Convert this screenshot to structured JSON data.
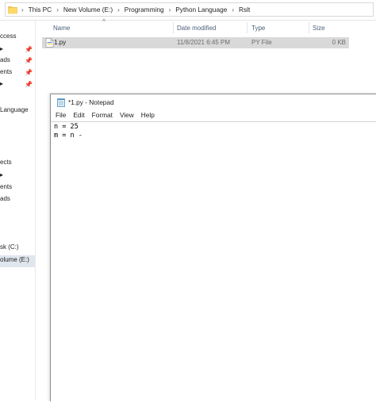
{
  "explorer": {
    "breadcrumbs": [
      "This PC",
      "New Volume (E:)",
      "Programming",
      "Python Language",
      "Rslt"
    ],
    "columns": {
      "name": "Name",
      "date_modified": "Date modified",
      "type": "Type",
      "size": "Size"
    },
    "files": [
      {
        "name": "1.py",
        "date_modified": "11/8/2021 6:45 PM",
        "type": "PY File",
        "size": "0 KB"
      }
    ],
    "sidebar_items": [
      {
        "label": "ccess",
        "pinned": false
      },
      {
        "label": "▸",
        "pinned": true
      },
      {
        "label": "ads",
        "pinned": true
      },
      {
        "label": "ents",
        "pinned": true
      },
      {
        "label": "▸",
        "pinned": true
      },
      {
        "label": "Language",
        "pinned": false
      },
      {
        "label": "ects",
        "pinned": false
      },
      {
        "label": "▸",
        "pinned": false
      },
      {
        "label": "ents",
        "pinned": false
      },
      {
        "label": "ads",
        "pinned": false
      },
      {
        "label": "sk (C:)",
        "pinned": false
      },
      {
        "label": "olume (E:)",
        "pinned": false,
        "selected": true
      }
    ]
  },
  "notepad": {
    "title": "*1.py - Notepad",
    "menu": [
      "File",
      "Edit",
      "Format",
      "View",
      "Help"
    ],
    "lines": [
      "n = 25",
      "m = n -"
    ]
  },
  "colors": {
    "selected_row": "#d9d9d9",
    "header_text": "#4c607a",
    "nav_selected": "#dfe6ee"
  }
}
